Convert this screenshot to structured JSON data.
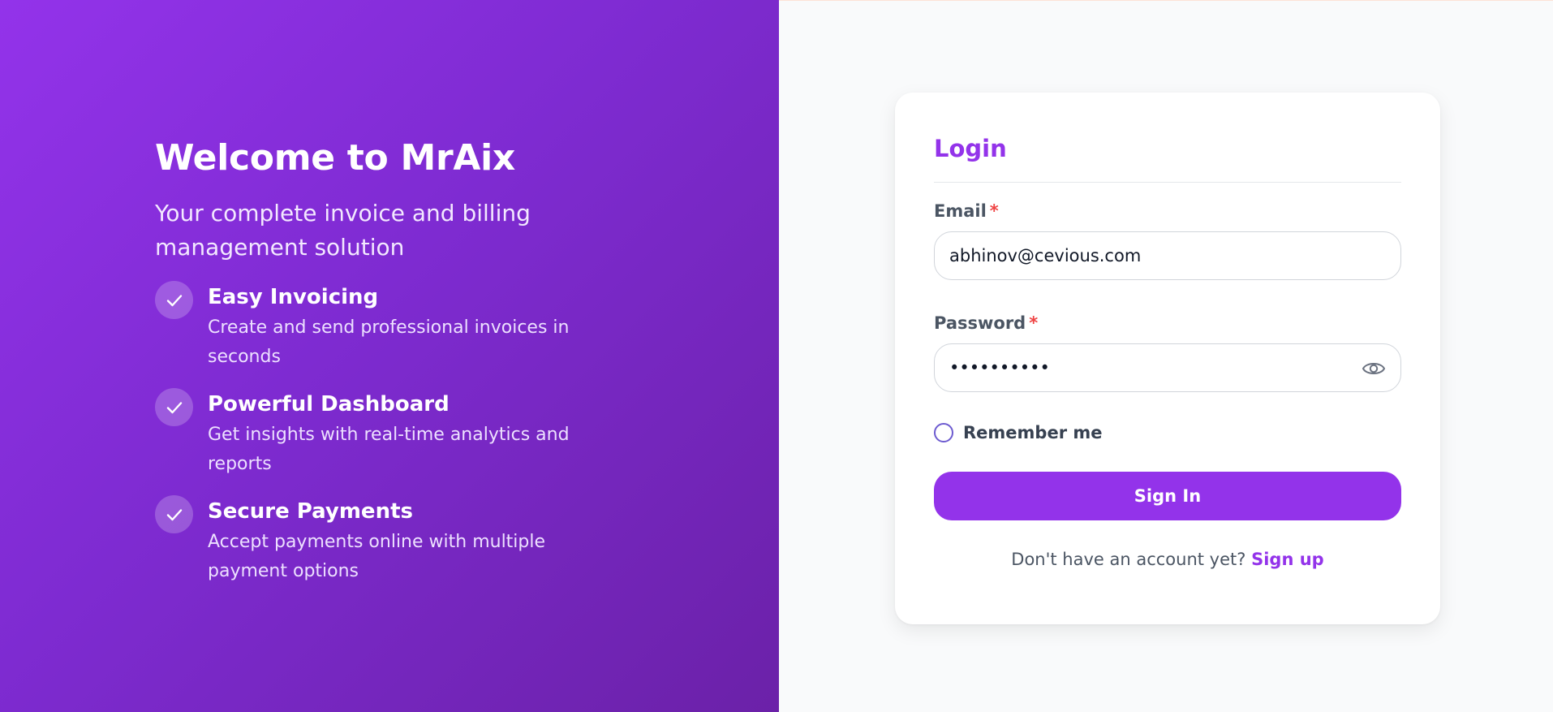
{
  "brand": {
    "title": "Welcome to MrAix",
    "subtitle": "Your complete invoice and billing management solution"
  },
  "features": [
    {
      "title": "Easy Invoicing",
      "description": "Create and send professional invoices in seconds",
      "icon": "check-icon"
    },
    {
      "title": "Powerful Dashboard",
      "description": "Get insights with real-time analytics and reports",
      "icon": "check-icon"
    },
    {
      "title": "Secure Payments",
      "description": "Accept payments online with multiple payment options",
      "icon": "check-icon"
    }
  ],
  "login": {
    "title": "Login",
    "email_label": "Email",
    "email_value": "abhinov@cevious.com",
    "password_label": "Password",
    "password_value": "••••••••••",
    "required_mark": "*",
    "remember_label": "Remember me",
    "signin_label": "Sign In",
    "no_account_text": "Don't have an account yet?",
    "signup_label": "Sign up",
    "password_toggle_icon": "eye-icon"
  },
  "colors": {
    "brand_purple": "#9333ea",
    "gradient_start": "#9333ea",
    "gradient_end": "#6b21a8",
    "required": "#ef4444"
  }
}
